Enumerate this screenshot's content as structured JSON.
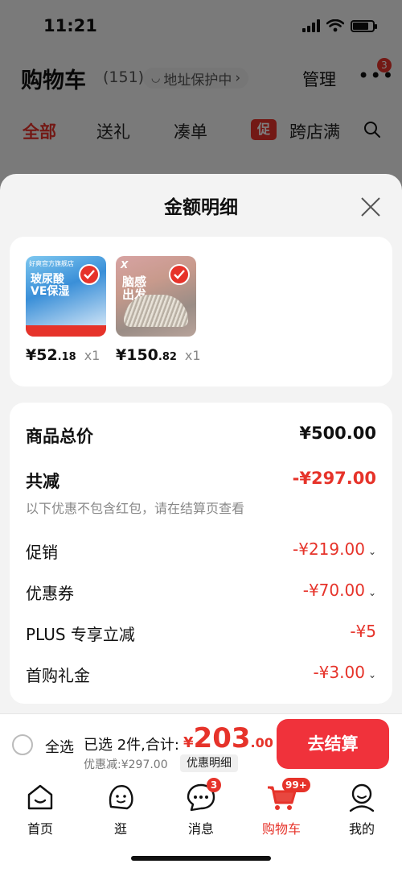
{
  "status": {
    "time": "11:21"
  },
  "cart_header": {
    "title": "购物车",
    "count": "(151)",
    "address_protect": "地址保护中",
    "manage": "管理",
    "more_badge": "3"
  },
  "cart_tabs": {
    "all": "全部",
    "gift": "送礼",
    "combine": "凑单",
    "promo_chip": "促",
    "cross_store": "跨店满"
  },
  "sheet": {
    "title": "金额明细",
    "items": [
      {
        "price_int": "¥52",
        "price_dec": ".18",
        "qty": "x1",
        "brand_text": "玻尿酸\nVE保湿",
        "top_text": "好爽宫方旗舰店"
      },
      {
        "price_int": "¥150",
        "price_dec": ".82",
        "qty": "x1",
        "brand_text": "脑感\n出发",
        "top_text": "X"
      }
    ],
    "details": {
      "total_label": "商品总价",
      "total_value": "¥500.00",
      "reduce_label": "共减",
      "reduce_value": "-¥297.00",
      "reduce_note": "以下优惠不包含红包，请在结算页查看",
      "promo_label": "促销",
      "promo_value": "-¥219.00",
      "coupon_label": "优惠券",
      "coupon_value": "-¥70.00",
      "plus_label": "PLUS 专享立减",
      "plus_value": "-¥5",
      "firstbuy_label": "首购礼金",
      "firstbuy_value": "-¥3.00"
    }
  },
  "checkout": {
    "select_all": "全选",
    "selected": "已选 2件,合计:",
    "total_sym": "¥",
    "total_int": "203",
    "total_dec": ".00",
    "discount": "优惠减:¥297.00",
    "detail_chip": "优惠明细",
    "button": "去结算"
  },
  "tabbar": {
    "home": "首页",
    "browse": "逛",
    "messages": "消息",
    "messages_badge": "3",
    "cart": "购物车",
    "cart_badge": "99+",
    "mine": "我的"
  },
  "colors": {
    "accent": "#e6332a",
    "button": "#f0323b"
  }
}
